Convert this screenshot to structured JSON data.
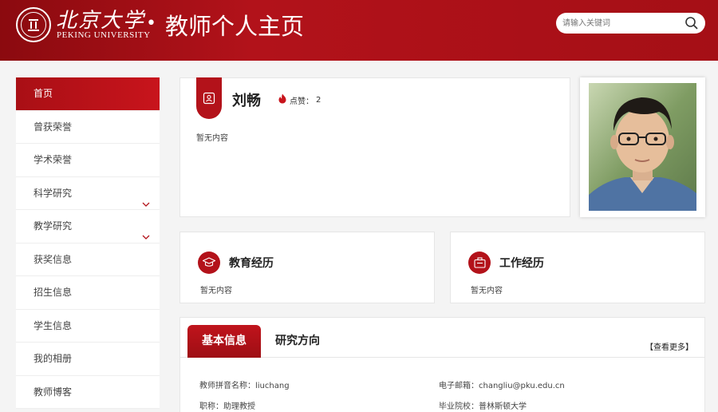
{
  "header": {
    "logo_cn": "北京大学",
    "logo_en": "PEKING UNIVERSITY",
    "site_title": "教师个人主页",
    "search_placeholder": "请输入关键词"
  },
  "sidebar": {
    "items": [
      {
        "label": "首页",
        "active": true,
        "expandable": false
      },
      {
        "label": "曾获荣誉",
        "active": false,
        "expandable": false
      },
      {
        "label": "学术荣誉",
        "active": false,
        "expandable": false
      },
      {
        "label": "科学研究",
        "active": false,
        "expandable": true
      },
      {
        "label": "教学研究",
        "active": false,
        "expandable": true
      },
      {
        "label": "获奖信息",
        "active": false,
        "expandable": false
      },
      {
        "label": "招生信息",
        "active": false,
        "expandable": false
      },
      {
        "label": "学生信息",
        "active": false,
        "expandable": false
      },
      {
        "label": "我的相册",
        "active": false,
        "expandable": false
      },
      {
        "label": "教师博客",
        "active": false,
        "expandable": false
      }
    ]
  },
  "profile": {
    "name": "刘畅",
    "likes_label": "点赞：",
    "likes_count": "2",
    "bio": "暂无内容"
  },
  "education": {
    "title": "教育经历",
    "content": "暂无内容"
  },
  "work": {
    "title": "工作经历",
    "content": "暂无内容"
  },
  "info": {
    "tabs": [
      "基本信息",
      "研究方向"
    ],
    "more": "【查看更多】",
    "fields": {
      "pinyin": "教师拼音名称：liuchang",
      "email": "电子邮箱：changliu@pku.edu.cn",
      "title": "职称：助理教授",
      "school": "毕业院校：普林斯顿大学"
    }
  },
  "colors": {
    "brand_red": "#b3121a",
    "dark_red": "#8b0a0f"
  },
  "icons": {
    "search": "search-icon",
    "like": "flame-icon",
    "profile_tab": "id-card-icon",
    "education": "graduation-cap-icon",
    "work": "briefcase-icon",
    "chevron": "chevron-down-icon"
  }
}
